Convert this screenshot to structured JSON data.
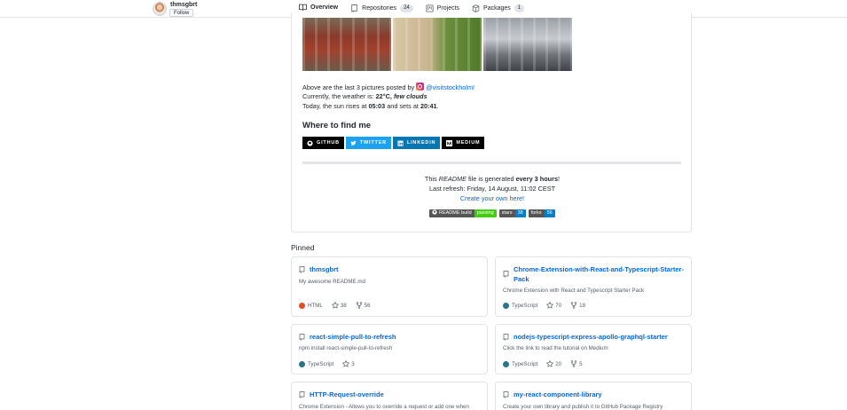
{
  "profile": {
    "username": "thmsgbrt",
    "follow_label": "Follow"
  },
  "tabs": [
    {
      "label": "Overview",
      "icon": "book-icon",
      "active": true
    },
    {
      "label": "Repositories",
      "icon": "repo-icon",
      "count": "24"
    },
    {
      "label": "Projects",
      "icon": "project-icon"
    },
    {
      "label": "Packages",
      "icon": "package-icon",
      "count": "1"
    }
  ],
  "readme": {
    "pictures_prefix": "Above are the last 3 pictures posted by",
    "instagram_handle": "@visitstockholm!",
    "weather_prefix": "Currently, the weather is:",
    "weather_temp": "22°C,",
    "weather_desc": "few clouds",
    "sun_prefix": "Today, the sun rises at",
    "sunrise": "05:03",
    "sun_mid": "and sets at",
    "sunset": "20:41",
    "where_heading": "Where to find me",
    "social": [
      {
        "label": "GITHUB",
        "icon": "github-icon"
      },
      {
        "label": "TWITTER",
        "icon": "twitter-icon"
      },
      {
        "label": "LINKEDIN",
        "icon": "linkedin-icon"
      },
      {
        "label": "MEDIUM",
        "icon": "medium-icon"
      }
    ],
    "generated_prefix": "This",
    "generated_readme": "README",
    "generated_mid": "file is generated",
    "generated_bold": "every 3 hours",
    "generated_end": "!",
    "last_refresh": "Last refresh: Friday, 14 August, 11:02 CEST",
    "create_link": "Create your own here!",
    "badges": [
      {
        "left": "README build",
        "right": "passing",
        "color": "#44cc11"
      },
      {
        "left": "stars",
        "right": "38",
        "color": "#007ec6"
      },
      {
        "left": "forks",
        "right": "56",
        "color": "#007ec6"
      }
    ]
  },
  "pinned": {
    "title": "Pinned",
    "repos": [
      {
        "name": "thmsgbrt",
        "desc": "My awesome README.md",
        "lang": "HTML",
        "lang_color": "#e34c26",
        "stars": "38",
        "forks": "56"
      },
      {
        "name_line1": "Chrome-Extension-with-React-and-Typescript-Starter-",
        "name_line2": "Pack",
        "desc": "Chrome Extension with React and Typescript Starter Pack",
        "lang": "TypeScript",
        "lang_color": "#2b7489",
        "stars": "70",
        "forks": "18"
      },
      {
        "name": "react-simple-pull-to-refresh",
        "desc": "npm install react-simple-pull-to-refresh",
        "lang": "TypeScript",
        "lang_color": "#2b7489",
        "stars": "3"
      },
      {
        "name": "nodejs-typescript-express-apollo-graphql-starter",
        "desc": "Click the link to read the tutorial on Medium",
        "lang": "TypeScript",
        "lang_color": "#2b7489",
        "stars": "20",
        "forks": "5"
      },
      {
        "name": "HTTP-Request-override",
        "desc": "Chrome Extension - Allows you to override a request or add one when"
      },
      {
        "name": "my-react-component-library",
        "desc": "Create your own library and publish it to GitHub Package Registry"
      }
    ]
  }
}
